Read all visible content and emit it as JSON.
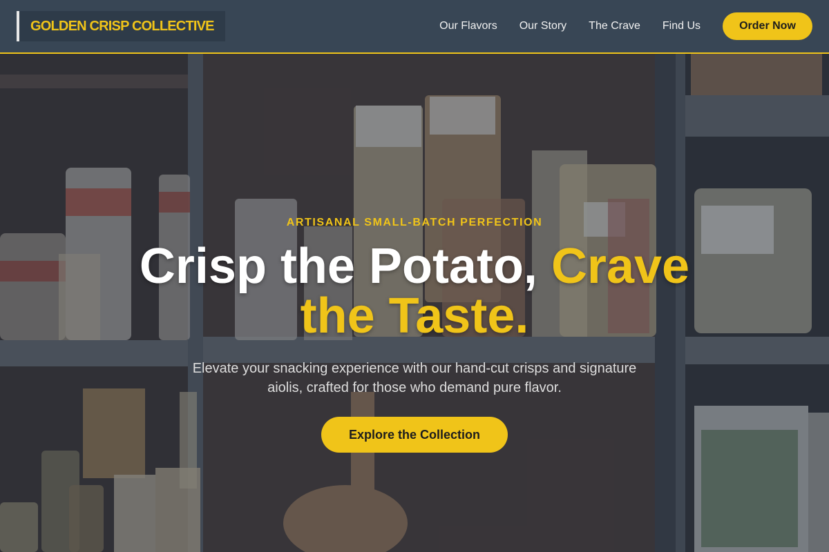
{
  "nav": {
    "brand": "GOLDEN CRISP COLLECTIVE",
    "links": [
      "Our Flavors",
      "Our Story",
      "The Crave",
      "Find Us"
    ],
    "order_label": "Order Now"
  },
  "hero": {
    "eyebrow": "ARTISANAL SMALL-BATCH PERFECTION",
    "headline_part1": "Crisp the Potato, ",
    "headline_accent_line1": "Crave",
    "headline_accent_line2": "the Taste.",
    "subtext": "Elevate your snacking experience with our hand-cut crisps and signature aiolis, crafted for those who demand pure flavor.",
    "cta_label": "Explore the Collection",
    "background": "pantry shelves with bagged pasta, jars and a wooden paddle"
  },
  "colors": {
    "accent": "#f0c419",
    "nav_bg": "#384655",
    "overlay": "#26303e"
  }
}
